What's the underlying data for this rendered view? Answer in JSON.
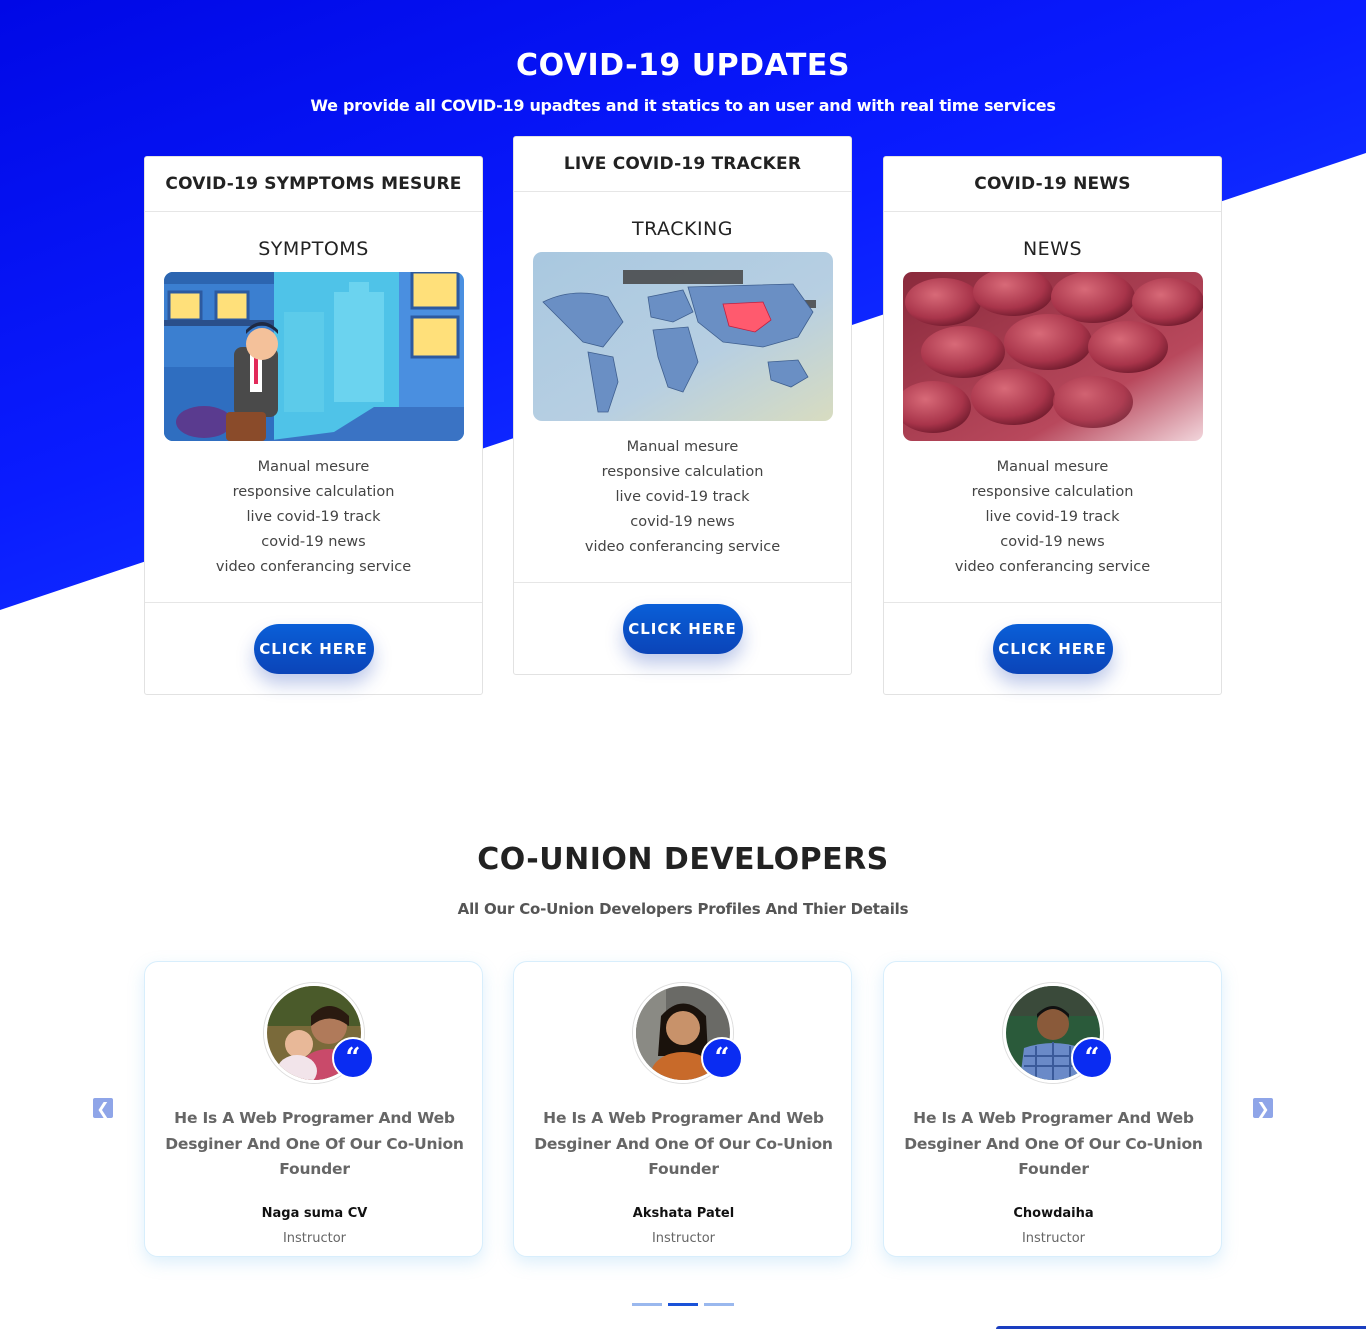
{
  "hero": {
    "title": "COVID-19 UPDATES",
    "subtitle": "We provide all COVID-19 upadtes and it statics to an user and with real time services"
  },
  "cards": [
    {
      "header": "COVID-19 SYMPTOMS MESURE",
      "subtitle": "SYMPTOMS",
      "image": "man-with-suitcase-illustration",
      "features": [
        "Manual mesure",
        "responsive calculation",
        "live covid-19 track",
        "covid-19 news",
        "video conferancing service"
      ],
      "button": "CLICK HERE"
    },
    {
      "header": "LIVE COVID-19 TRACKER",
      "subtitle": "TRACKING",
      "image": "world-map-china-highlighted",
      "features": [
        "Manual mesure",
        "responsive calculation",
        "live covid-19 track",
        "covid-19 news",
        "video conferancing service"
      ],
      "button": "CLICK HERE"
    },
    {
      "header": "COVID-19 NEWS",
      "subtitle": "NEWS",
      "image": "red-blood-cells-closeup",
      "features": [
        "Manual mesure",
        "responsive calculation",
        "live covid-19 track",
        "covid-19 news",
        "video conferancing service"
      ],
      "button": "CLICK HERE"
    }
  ],
  "developers": {
    "title": "CO-UNION DEVELOPERS",
    "subtitle": "All Our Co-Union Developers Profiles And Thier Details",
    "people": [
      {
        "quote": "He Is A Web Programer And Web Desginer And One Of Our Co-Union Founder",
        "name": "Naga suma CV",
        "role": "Instructor",
        "avatar": "woman-with-baby-photo"
      },
      {
        "quote": "He Is A Web Programer And Web Desginer And One Of Our Co-Union Founder",
        "name": "Akshata Patel",
        "role": "Instructor",
        "avatar": "woman-portrait-photo"
      },
      {
        "quote": "He Is A Web Programer And Web Desginer And One Of Our Co-Union Founder",
        "name": "Chowdaiha",
        "role": "Instructor",
        "avatar": "man-checked-shirt-photo"
      }
    ],
    "quote_icon": "quote-icon",
    "carousel": {
      "prev": "chevron-left-icon",
      "next": "chevron-right-icon",
      "slides": 3,
      "active_slide": 2
    }
  },
  "colors": {
    "hero_blue": "#0a1cff",
    "button_blue": "#0b50c8",
    "quote_badge": "#0a2cf2"
  }
}
